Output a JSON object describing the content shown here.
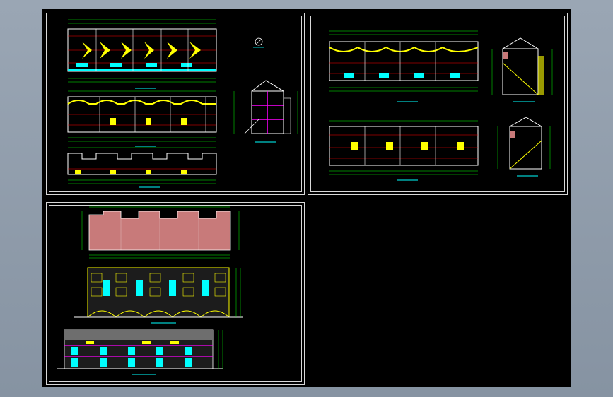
{
  "app": {
    "viewport_name": "cad-drawing-canvas"
  },
  "sheets": [
    {
      "id": "sheet-1",
      "title": "",
      "drawings": [
        "floor-plan-1",
        "floor-plan-2",
        "floor-plan-3",
        "section-1"
      ]
    },
    {
      "id": "sheet-2",
      "title": "",
      "drawings": [
        "floor-plan-4",
        "floor-plan-5",
        "section-2",
        "section-3"
      ]
    },
    {
      "id": "sheet-3",
      "title": "",
      "drawings": [
        "roof-plan",
        "elevation-1",
        "elevation-2"
      ]
    }
  ],
  "colors": {
    "background_outer": "#8a96a4",
    "canvas": "#000000",
    "frame": "#d8d8d8",
    "wall": "#ffffff",
    "yellow": "#ffff00",
    "cyan": "#00ffff",
    "red": "#ff0000",
    "magenta": "#ff00ff",
    "green": "#00ff00",
    "blue": "#3050ff",
    "roof_fill": "#c87a7a"
  },
  "labels": {
    "north_symbol": "N"
  }
}
